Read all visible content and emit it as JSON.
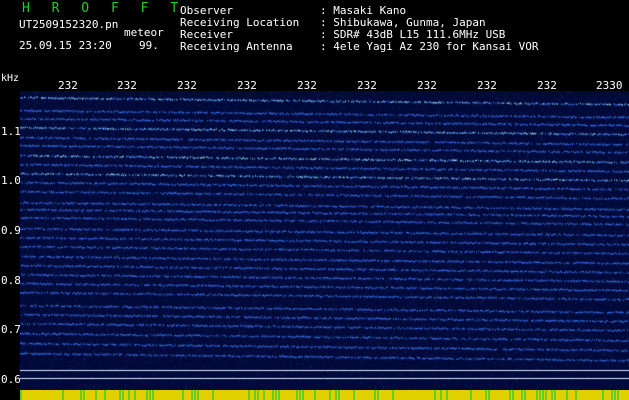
{
  "header": {
    "logo": "H R O F F T",
    "filename": "UT2509152320.pn",
    "tag": "meteor",
    "datetime": "25.09.15 23:20",
    "percent": "99.",
    "info": [
      {
        "label": "Observer",
        "value": ": Masaki Kano"
      },
      {
        "label": "Receiving Location",
        "value": ": Shibukawa, Gunma, Japan"
      },
      {
        "label": "Receiver",
        "value": ": SDR# 43dB L15 111.6MHz USB"
      },
      {
        "label": "Receiving Antenna",
        "value": ": 4ele Yagi Az 230 for Kansai VOR"
      }
    ]
  },
  "axis": {
    "unit": "kHz",
    "time_ticks": [
      "232",
      "232",
      "232",
      "232",
      "232",
      "232",
      "232",
      "232",
      "232",
      "2330"
    ],
    "freq_labels": [
      "1.1",
      "1.0",
      "0.9",
      "0.8",
      "0.7",
      "0.6"
    ]
  },
  "colors": {
    "logo": "#22cc22",
    "text": "#ffffff",
    "background": "#000000",
    "spectrogram_base": "#000a3a",
    "trace": "#3b7bff",
    "trace_bright": "#9fe8ff",
    "bottom_strip": "#e0d000"
  }
}
